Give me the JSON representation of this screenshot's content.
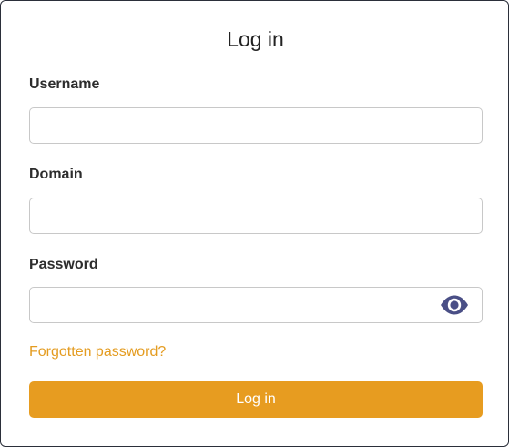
{
  "dialog": {
    "title": "Log in"
  },
  "form": {
    "username": {
      "label": "Username",
      "value": "",
      "placeholder": ""
    },
    "domain": {
      "label": "Domain",
      "value": "",
      "placeholder": ""
    },
    "password": {
      "label": "Password",
      "value": "",
      "placeholder": "",
      "toggle_icon": "eye-icon"
    },
    "forgot_link": "Forgotten password?",
    "submit_label": "Log in"
  },
  "colors": {
    "accent": "#e79c20",
    "link": "#e49c21",
    "icon": "#4a4f86",
    "border": "#c8c8c8"
  }
}
